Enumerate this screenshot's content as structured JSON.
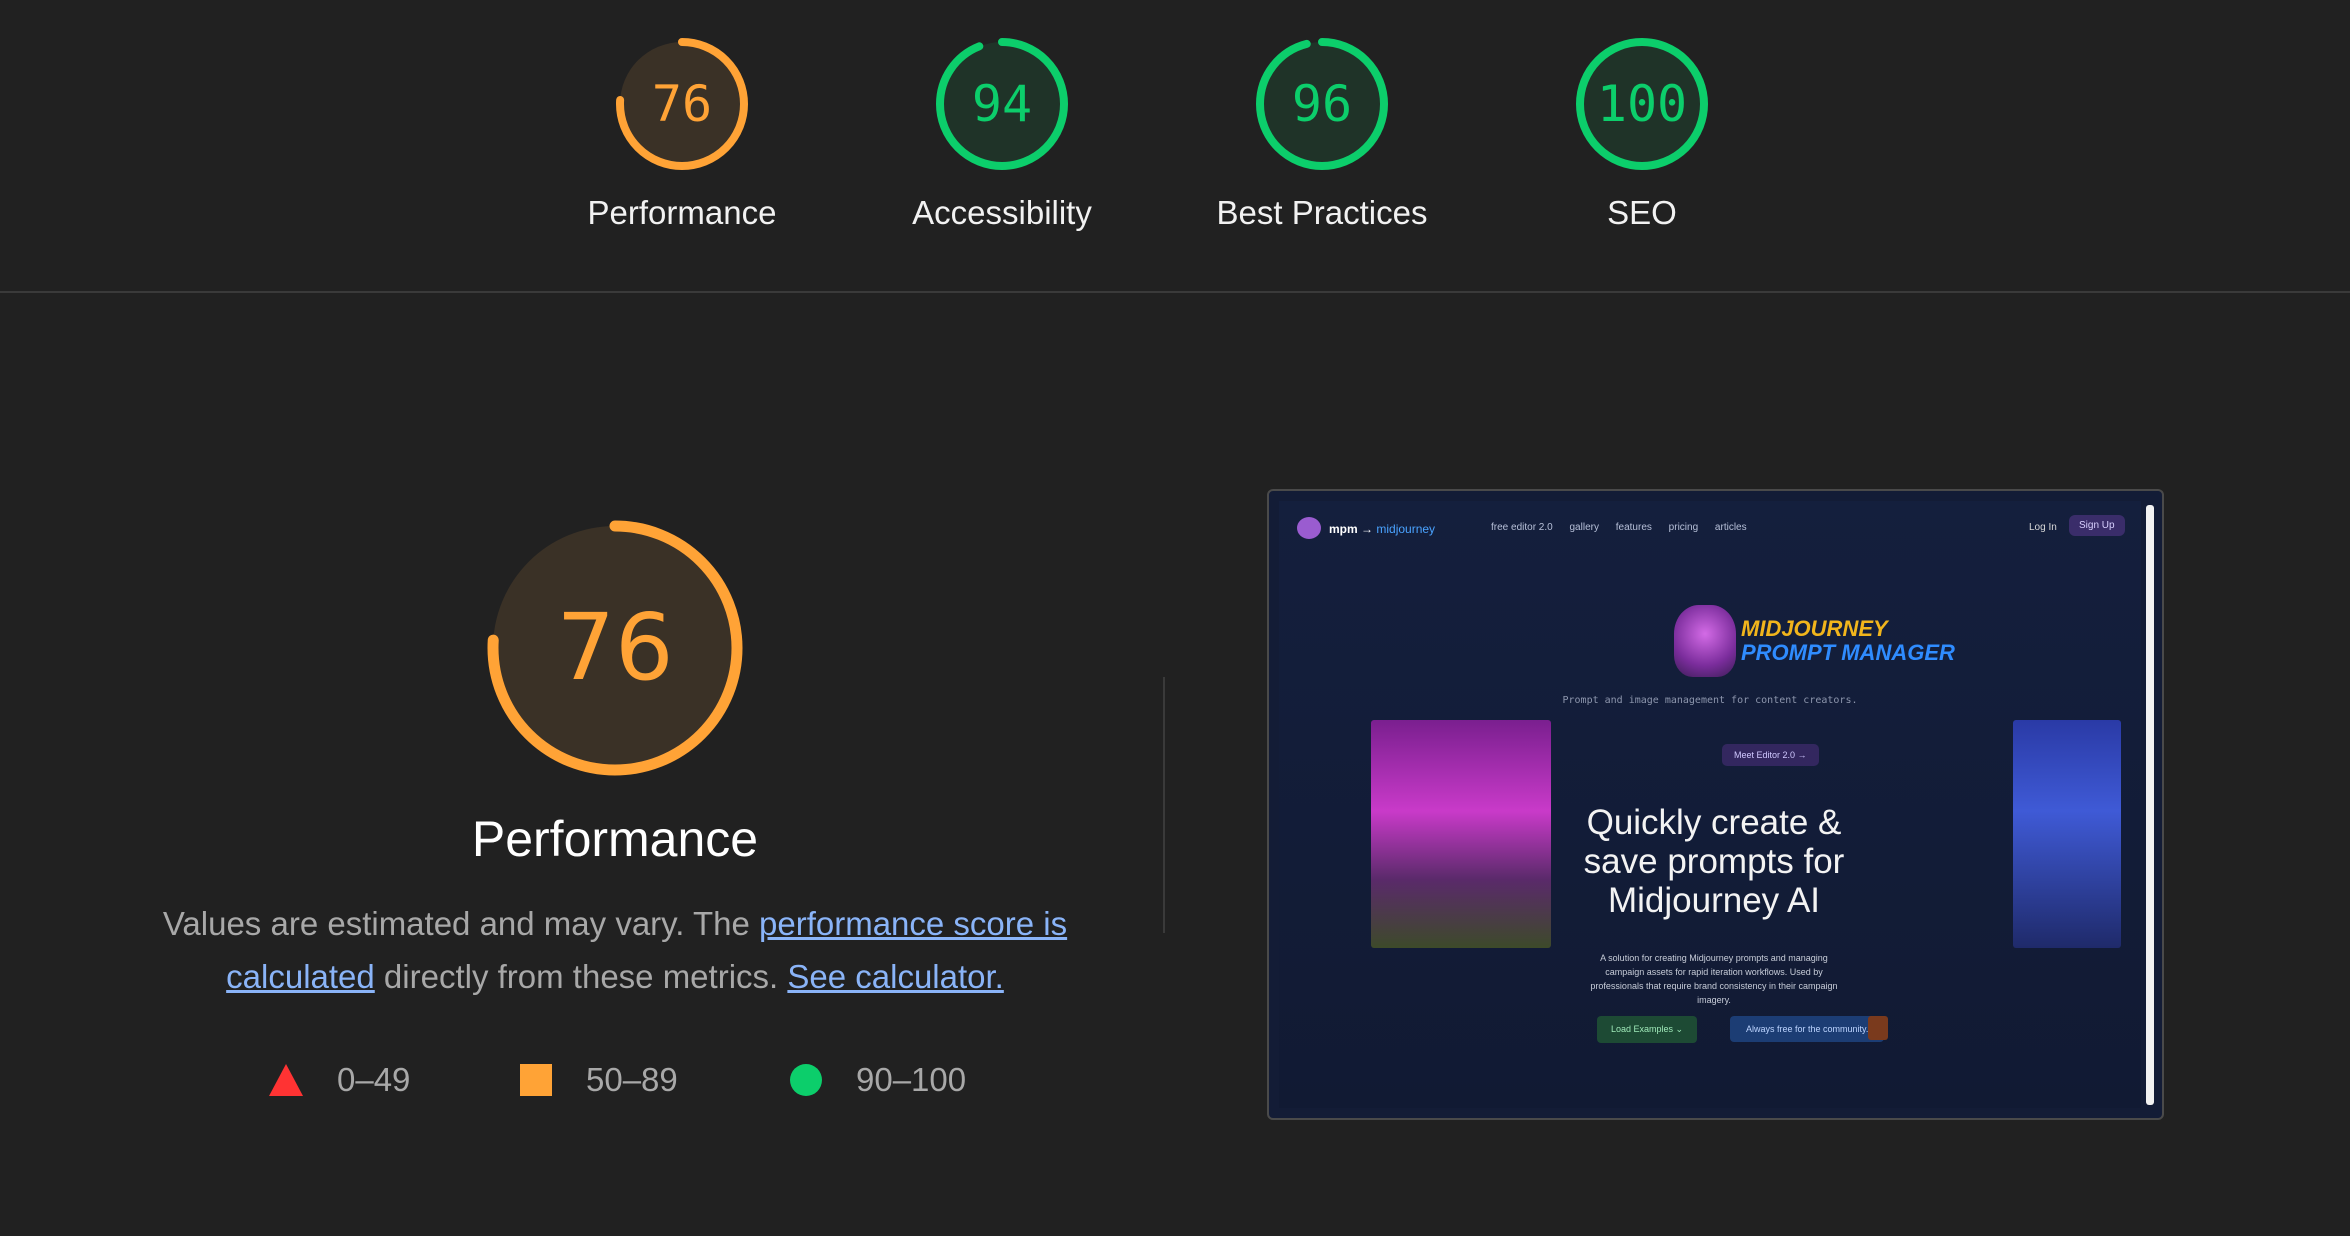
{
  "summary_gauges": [
    {
      "score": "76",
      "label": "Performance",
      "fraction": 0.76,
      "color": "#ffa336"
    },
    {
      "score": "94",
      "label": "Accessibility",
      "fraction": 0.94,
      "color": "#0cce6b"
    },
    {
      "score": "96",
      "label": "Best Practices",
      "fraction": 0.96,
      "color": "#0cce6b"
    },
    {
      "score": "100",
      "label": "SEO",
      "fraction": 1.0,
      "color": "#0cce6b"
    }
  ],
  "performance": {
    "score": "76",
    "fraction": 0.76,
    "title": "Performance",
    "desc_prefix": "Values are estimated and may vary. The ",
    "desc_link1": "performance score is calculated",
    "desc_middle": " directly from these metrics. ",
    "desc_link2": "See calculator."
  },
  "legend": [
    {
      "icon": "triangle-icon",
      "range": "0–49",
      "color": "#ff3333"
    },
    {
      "icon": "square-icon",
      "range": "50–89",
      "color": "#ffa336"
    },
    {
      "icon": "circle-icon",
      "range": "90–100",
      "color": "#0cce6b"
    }
  ],
  "screenshot": {
    "brand": "mpm →",
    "brand_accent": "midjourney",
    "nav_links": [
      "free editor 2.0",
      "gallery",
      "features",
      "pricing",
      "articles"
    ],
    "login": "Log In",
    "signup": "Sign Up",
    "logo_line1": "MIDJOURNEY",
    "logo_line2": "PROMPT MANAGER",
    "tagline": "Prompt and image management for content creators.",
    "meet_button": "Meet Editor 2.0 →",
    "headline": "Quickly create & save prompts for Midjourney AI",
    "subtext": "A solution for creating Midjourney prompts and managing campaign assets for rapid iteration workflows. Used by professionals that require brand consistency in their campaign imagery.",
    "load_examples": "Load Examples ⌄",
    "always_free": "Always free for the community."
  }
}
